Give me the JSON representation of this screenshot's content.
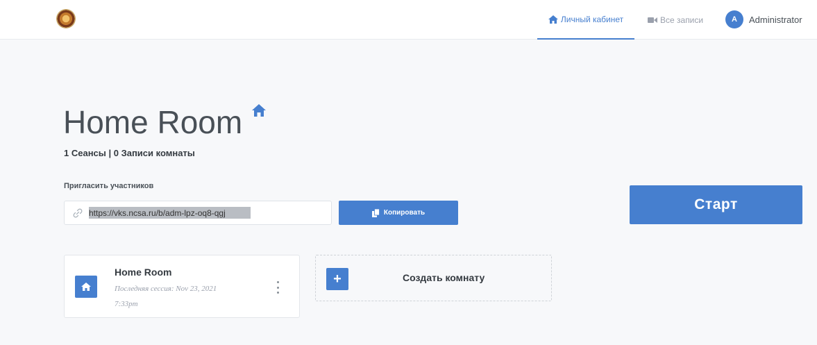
{
  "header": {
    "nav": {
      "home_label": "Личный кабинет",
      "recordings_label": "Все записи"
    },
    "user": {
      "initial": "A",
      "name": "Administrator"
    }
  },
  "main": {
    "title": "Home Room",
    "stats": "1 Сеансы | 0 Записи комнаты",
    "invite_label": "Пригласить участников",
    "invite_url": "https://vks.ncsa.ru/b/adm-lpz-oq8-qgj",
    "copy_label": "Копировать",
    "start_label": "Старт"
  },
  "rooms": {
    "card": {
      "name": "Home Room",
      "last_session": "Последняя сессия: Nov 23, 2021 7:33pm"
    },
    "create_plus": "+",
    "create_label": "Создать комнату"
  },
  "colors": {
    "accent": "#467fcf",
    "background": "#f7f8fa"
  },
  "icons": {
    "logo": "emblem-logo",
    "home": "home-icon",
    "recordings": "video-camera-icon",
    "link": "link-icon",
    "copy": "copy-icon",
    "menu": "kebab-menu-icon"
  }
}
